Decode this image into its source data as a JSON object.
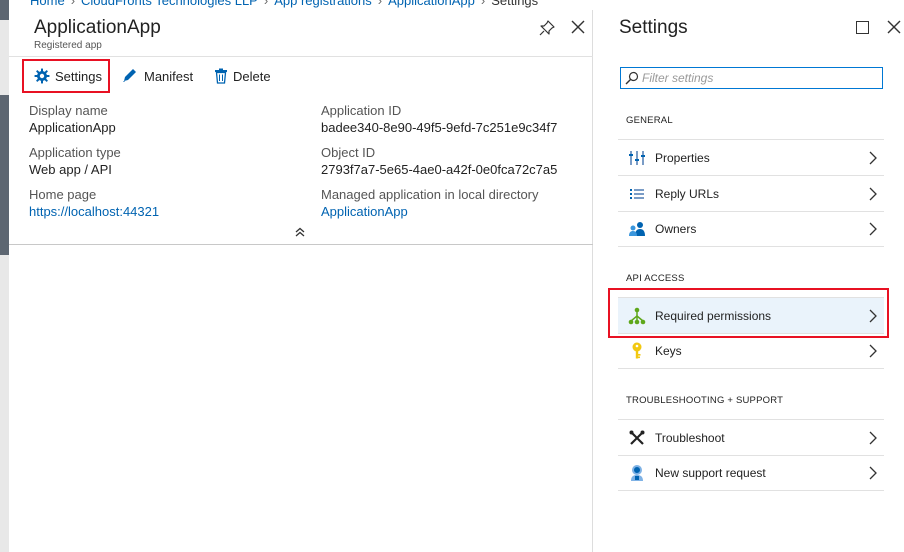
{
  "breadcrumb": {
    "items": [
      "Home",
      "CloudFronts Technologies LLP",
      "App registrations",
      "ApplicationApp"
    ],
    "current": "Settings"
  },
  "app_blade": {
    "title": "ApplicationApp",
    "subtitle": "Registered app",
    "toolbar": {
      "settings_label": "Settings",
      "manifest_label": "Manifest",
      "delete_label": "Delete"
    },
    "essentials": {
      "display_name_label": "Display name",
      "display_name_value": "ApplicationApp",
      "application_type_label": "Application type",
      "application_type_value": "Web app / API",
      "home_page_label": "Home page",
      "home_page_value": "https://localhost:44321",
      "application_id_label": "Application ID",
      "application_id_value": "badee340-8e90-49f5-9efd-7c251e9c34f7",
      "object_id_label": "Object ID",
      "object_id_value": "2793f7a7-5e65-4ae0-a42f-0e0fca72c7a5",
      "managed_app_label": "Managed application in local directory",
      "managed_app_value": "ApplicationApp"
    }
  },
  "settings_blade": {
    "title": "Settings",
    "filter_placeholder": "Filter settings",
    "sections": {
      "general": "GENERAL",
      "api_access": "API ACCESS",
      "troubleshooting": "TROUBLESHOOTING + SUPPORT"
    },
    "items": {
      "properties": "Properties",
      "reply_urls": "Reply URLs",
      "owners": "Owners",
      "required_permissions": "Required permissions",
      "keys": "Keys",
      "troubleshoot": "Troubleshoot",
      "new_support_request": "New support request"
    }
  },
  "colors": {
    "accent": "#0063b1",
    "highlight_border": "#e81123",
    "selected_row": "#eaf3fb"
  },
  "icons": [
    "settings-gear-icon",
    "manifest-pencil-icon",
    "delete-trash-icon",
    "pin-icon",
    "close-icon",
    "maximize-icon",
    "search-icon",
    "properties-icon",
    "reply-urls-icon",
    "owners-icon",
    "required-permissions-icon",
    "keys-icon",
    "troubleshoot-icon",
    "support-request-icon",
    "chevron-right-icon",
    "chevron-up-icon"
  ]
}
